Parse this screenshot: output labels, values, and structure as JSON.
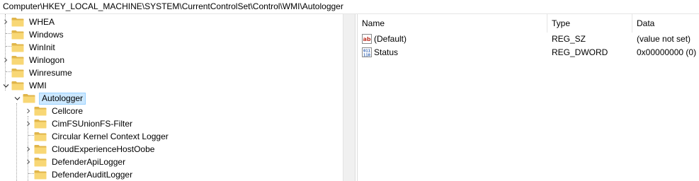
{
  "address": {
    "path": "Computer\\HKEY_LOCAL_MACHINE\\SYSTEM\\CurrentControlSet\\Control\\WMI\\Autologger"
  },
  "tree": {
    "items": [
      {
        "label": "WHEA",
        "icon": "folder-icon",
        "expander": "chevron-right-icon"
      },
      {
        "label": "Windows",
        "icon": "folder-icon",
        "expander": "none"
      },
      {
        "label": "WinInit",
        "icon": "folder-icon",
        "expander": "none"
      },
      {
        "label": "Winlogon",
        "icon": "folder-icon",
        "expander": "chevron-right-icon"
      },
      {
        "label": "Winresume",
        "icon": "folder-icon",
        "expander": "none"
      },
      {
        "label": "WMI",
        "icon": "folder-icon",
        "expander": "chevron-down-icon"
      },
      {
        "label": "Autologger",
        "icon": "folder-icon",
        "expander": "chevron-down-icon",
        "selected": true
      },
      {
        "label": "Cellcore",
        "icon": "folder-icon",
        "expander": "chevron-right-icon"
      },
      {
        "label": "CimFSUnionFS-Filter",
        "icon": "folder-icon",
        "expander": "chevron-right-icon"
      },
      {
        "label": "Circular Kernel Context Logger",
        "icon": "folder-icon",
        "expander": "none"
      },
      {
        "label": "CloudExperienceHostOobe",
        "icon": "folder-icon",
        "expander": "chevron-right-icon"
      },
      {
        "label": "DefenderApiLogger",
        "icon": "folder-icon",
        "expander": "chevron-right-icon"
      },
      {
        "label": "DefenderAuditLogger",
        "icon": "folder-icon",
        "expander": "none"
      }
    ]
  },
  "list": {
    "columns": [
      "Name",
      "Type",
      "Data"
    ],
    "rows": [
      {
        "icon": "string-value-icon",
        "name": "(Default)",
        "type": "REG_SZ",
        "data": "(value not set)"
      },
      {
        "icon": "binary-value-icon",
        "name": "Status",
        "type": "REG_DWORD",
        "data": "0x00000000 (0)"
      }
    ]
  },
  "colors": {
    "folder": "#f8d775",
    "folder_dark": "#e0b54a",
    "selection_bg": "#cce8ff",
    "selection_border": "#99d1ff",
    "string_icon": "#c0392b",
    "binary_icon": "#2a5db0"
  }
}
